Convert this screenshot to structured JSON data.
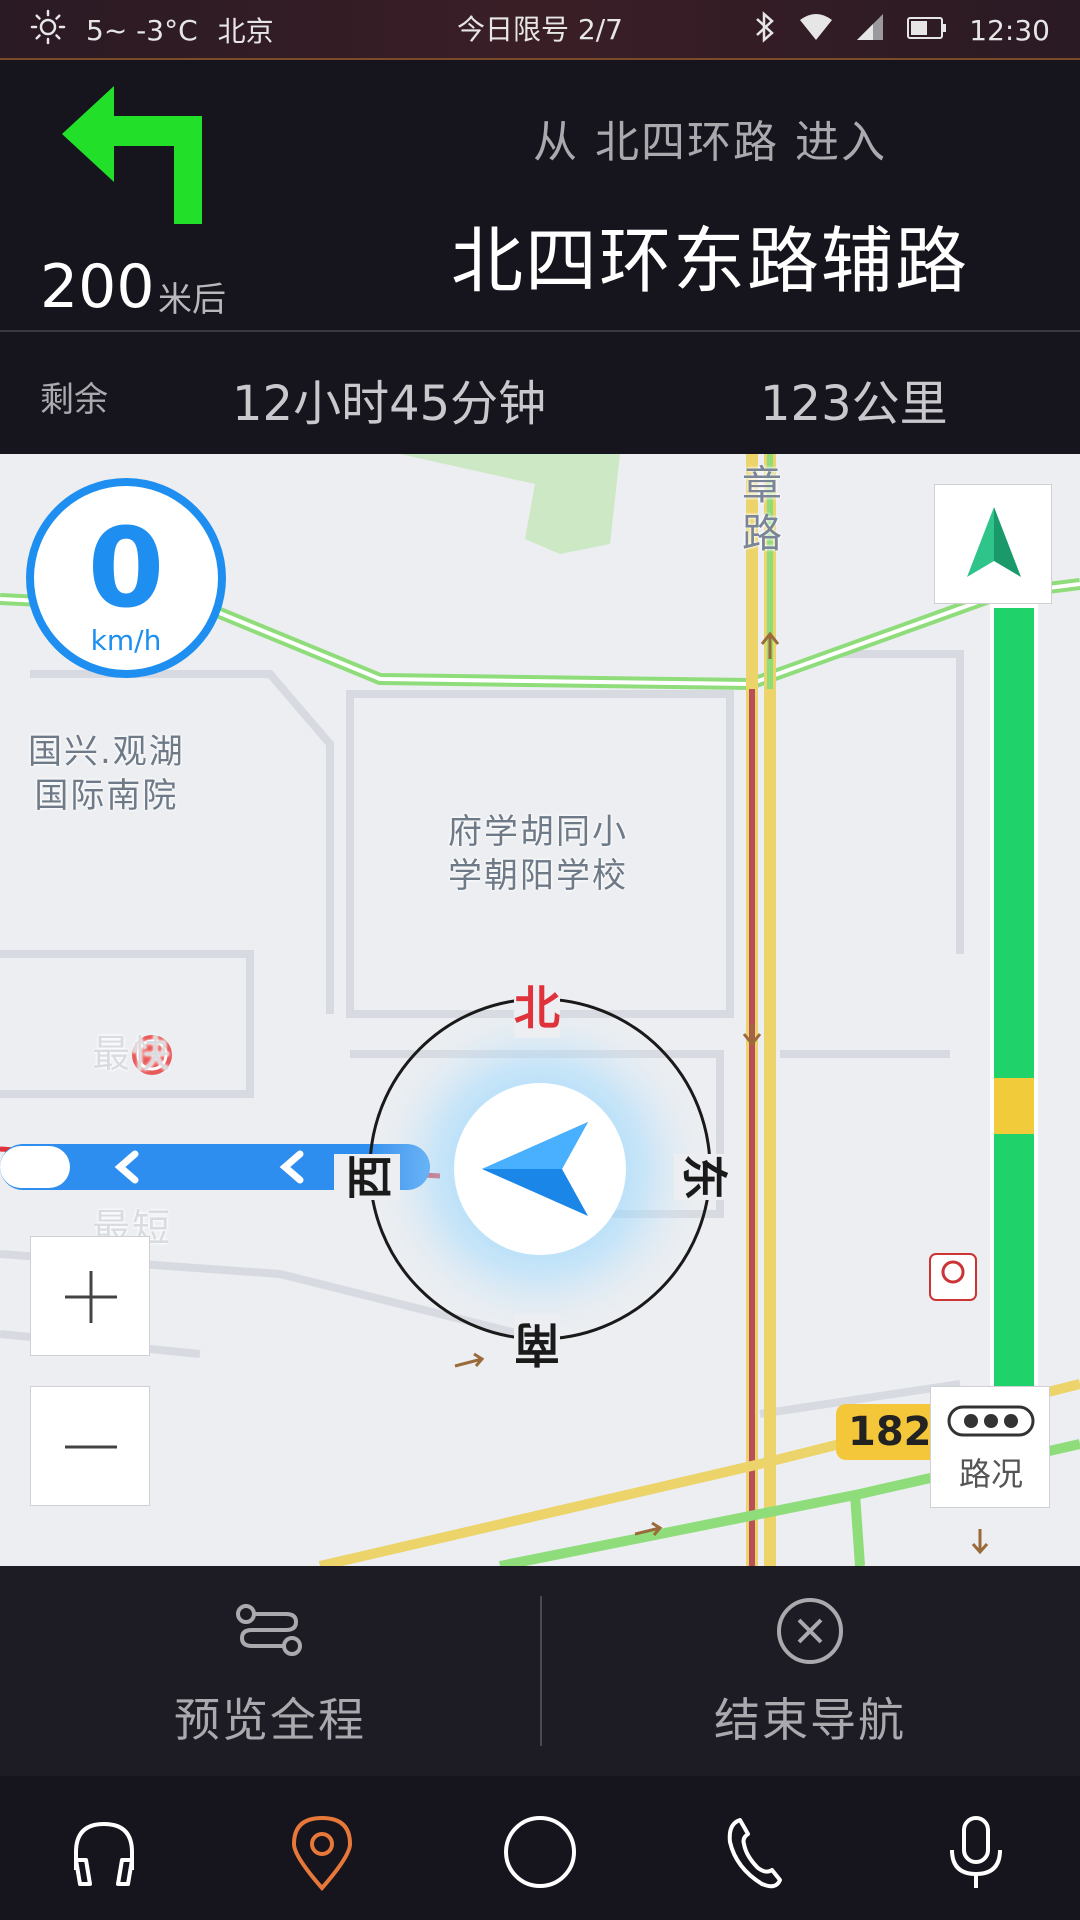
{
  "status_bar": {
    "weather": "5~ -3°C",
    "city": "北京",
    "restriction": "今日限号 2/7",
    "time": "12:30",
    "icons": [
      "sun-icon",
      "bluetooth-icon",
      "wifi-icon",
      "signal-icon",
      "battery-icon"
    ]
  },
  "guidance": {
    "turn": "left-turn-icon",
    "distance": "200",
    "distance_unit": "米后",
    "from_text": "从 北四环路 进入",
    "road_name": "北四环东路辅路"
  },
  "remaining": {
    "label": "剩余",
    "time": "12小时45分钟",
    "distance": "123公里"
  },
  "map": {
    "speed_value": "0",
    "speed_unit": "km/h",
    "pois": {
      "poi1_line1": "国兴.观湖",
      "poi1_line2": "国际南院",
      "poi2_line1": "府学胡同小",
      "poi2_line2": "学朝阳学校",
      "road_label_top": "章",
      "road_label_top2": "路",
      "faded_label1": "最快",
      "faded_label2": "最短"
    },
    "compass": {
      "north": "北",
      "south": "南",
      "east": "东",
      "west": "西"
    },
    "route_badge": "182米",
    "traffic_button_label": "路况",
    "traffic_colors": {
      "clear": "#1fd36a",
      "slow": "#f2cb3a"
    }
  },
  "actions": {
    "preview_label": "预览全程",
    "end_label": "结束导航"
  },
  "dock": {
    "items": [
      "headphones-icon",
      "location-pin-icon",
      "home-circle-icon",
      "phone-icon",
      "microphone-icon"
    ],
    "active_color": "#e8783a"
  }
}
